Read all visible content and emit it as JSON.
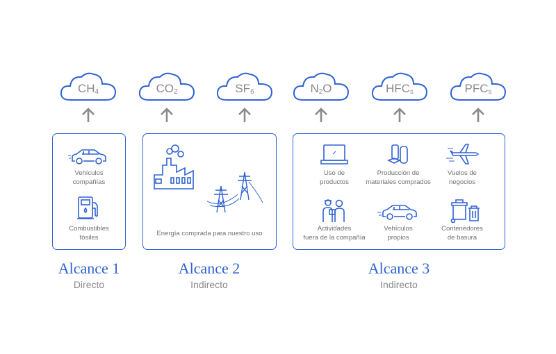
{
  "gases": [
    {
      "base": "CH",
      "sub": "4"
    },
    {
      "base": "CO",
      "sub": "2"
    },
    {
      "base": "SF",
      "sub": "6"
    },
    {
      "base": "N",
      "sub": "2",
      "tail": "O"
    },
    {
      "base": "HFC",
      "sub": "s"
    },
    {
      "base": "PFC",
      "sub": "s"
    }
  ],
  "scope1": {
    "title": "Alcance 1",
    "subtitle": "Directo",
    "items": [
      {
        "label1": "Vehículos",
        "label2": "compañías",
        "icon": "car-icon"
      },
      {
        "label1": "Combustibles",
        "label2": "fósiles",
        "icon": "fuel-pump-icon"
      }
    ]
  },
  "scope2": {
    "title": "Alcance 2",
    "subtitle": "Indirecto",
    "label": "Energía comprada para nuestro uso"
  },
  "scope3": {
    "title": "Alcance 3",
    "subtitle": "Indirecto",
    "items": [
      {
        "label1": "Uso de",
        "label2": "productos",
        "icon": "laptop-icon"
      },
      {
        "label1": "Producción de",
        "label2": "materiales comprados",
        "icon": "materials-icon"
      },
      {
        "label1": "Vuelos de",
        "label2": "negocios",
        "icon": "airplane-icon"
      },
      {
        "label1": "Actividades",
        "label2": "fuera de la compañía",
        "icon": "people-icon"
      },
      {
        "label1": "Vehículos",
        "label2": "propios",
        "icon": "car-icon"
      },
      {
        "label1": "Contenedores",
        "label2": "de basura",
        "icon": "trash-bins-icon"
      }
    ]
  },
  "colors": {
    "accent": "#2f62d4",
    "text": "#6f6f6f",
    "arrow": "#8a8a8a"
  }
}
